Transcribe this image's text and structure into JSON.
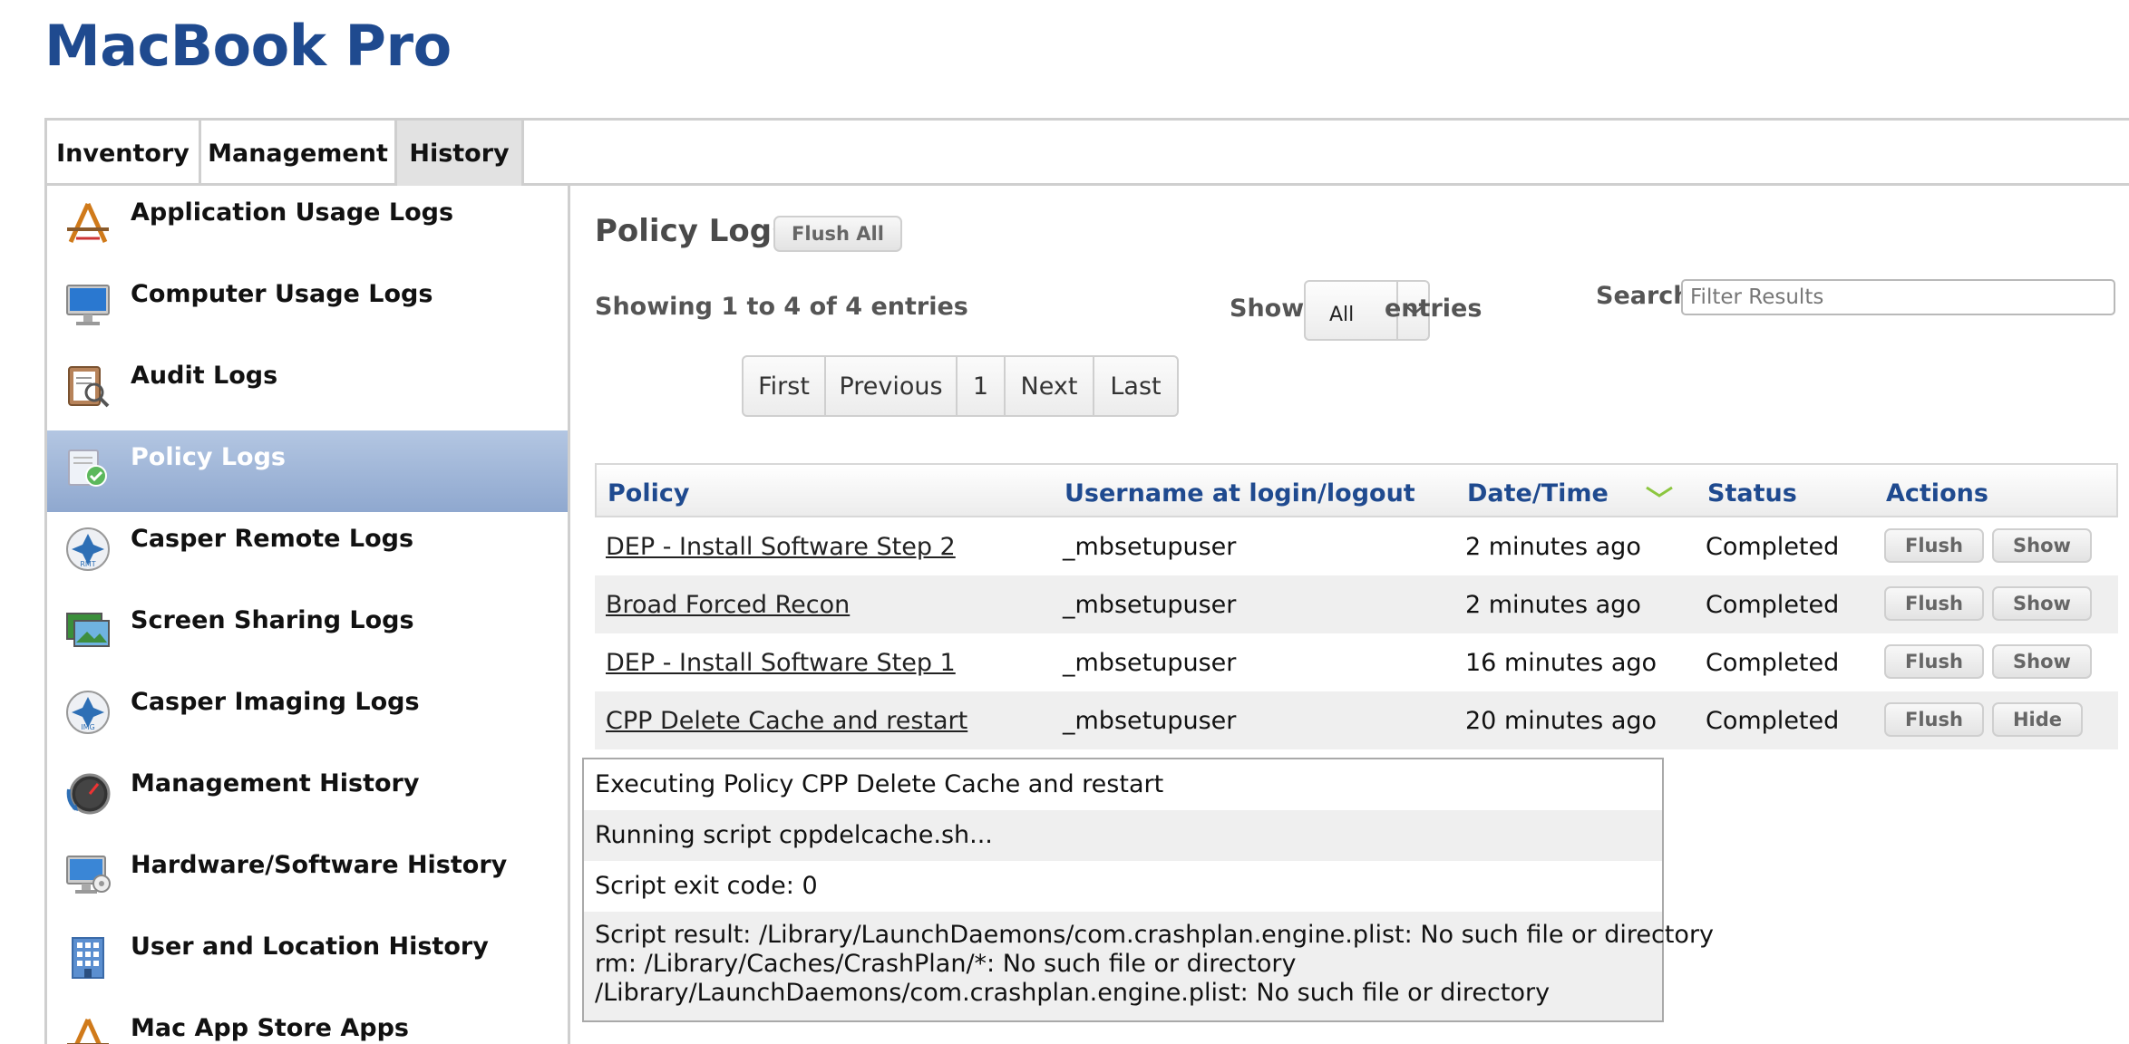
{
  "page": {
    "title": "MacBook Pro"
  },
  "tabs": [
    {
      "label": "Inventory",
      "active": false
    },
    {
      "label": "Management",
      "active": false
    },
    {
      "label": "History",
      "active": true
    }
  ],
  "sidebar": {
    "items": [
      {
        "label": "Application Usage Logs",
        "icon": "app-usage-icon",
        "active": false
      },
      {
        "label": "Computer Usage Logs",
        "icon": "computer-icon",
        "active": false
      },
      {
        "label": "Audit Logs",
        "icon": "audit-icon",
        "active": false
      },
      {
        "label": "Policy Logs",
        "icon": "policy-icon",
        "active": true
      },
      {
        "label": "Casper Remote Logs",
        "icon": "casper-remote-icon",
        "active": false
      },
      {
        "label": "Screen Sharing Logs",
        "icon": "screen-sharing-icon",
        "active": false
      },
      {
        "label": "Casper Imaging Logs",
        "icon": "casper-imaging-icon",
        "active": false
      },
      {
        "label": "Management History",
        "icon": "management-history-icon",
        "active": false
      },
      {
        "label": "Hardware/Software History",
        "icon": "hardware-software-icon",
        "active": false
      },
      {
        "label": "User and Location History",
        "icon": "user-location-icon",
        "active": false
      },
      {
        "label": "Mac App Store Apps",
        "icon": "app-store-icon",
        "active": false
      }
    ]
  },
  "main": {
    "title": "Policy Logs",
    "flush_all_label": "Flush All",
    "showing_text": "Showing 1 to 4 of 4 entries",
    "show_label": "Show",
    "show_value": "All",
    "entries_label": "entries",
    "search_label": "Search:",
    "search_placeholder": "Filter Results",
    "pager": {
      "first": "First",
      "previous": "Previous",
      "page": "1",
      "next": "Next",
      "last": "Last"
    },
    "table": {
      "columns": [
        "Policy",
        "Username at login/logout",
        "Date/Time",
        "Status",
        "Actions"
      ],
      "rows": [
        {
          "policy": "DEP - Install Software Step 2",
          "username": "_mbsetupuser",
          "datetime": "2 minutes ago",
          "status": "Completed",
          "action1": "Flush",
          "action2": "Show"
        },
        {
          "policy": "Broad Forced Recon",
          "username": "_mbsetupuser",
          "datetime": "2 minutes ago",
          "status": "Completed",
          "action1": "Flush",
          "action2": "Show"
        },
        {
          "policy": "DEP - Install Software Step 1",
          "username": "_mbsetupuser",
          "datetime": "16 minutes ago",
          "status": "Completed",
          "action1": "Flush",
          "action2": "Show"
        },
        {
          "policy": "CPP Delete Cache and restart",
          "username": "_mbsetupuser",
          "datetime": "20 minutes ago",
          "status": "Completed",
          "action1": "Flush",
          "action2": "Hide"
        }
      ]
    },
    "log_detail": {
      "line1": "Executing Policy CPP Delete Cache and restart",
      "line2": "Running script cppdelcache.sh...",
      "line3": "Script exit code: 0",
      "line4a": "Script result: /Library/LaunchDaemons/com.crashplan.engine.plist: No such file or directory",
      "line4b": "rm: /Library/Caches/CrashPlan/*: No such file or directory",
      "line4c": "/Library/LaunchDaemons/com.crashplan.engine.plist: No such file or directory"
    }
  }
}
